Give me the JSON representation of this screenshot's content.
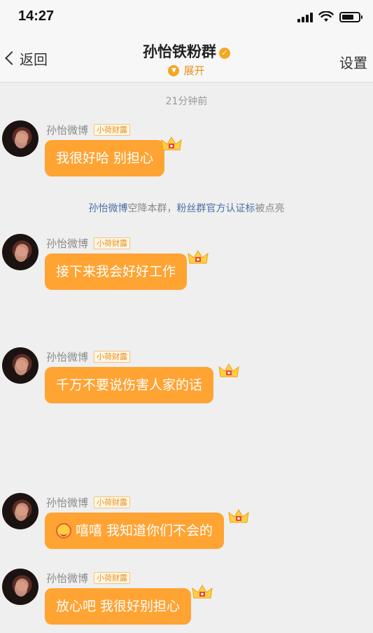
{
  "status_bar": {
    "time": "14:27"
  },
  "nav": {
    "back_label": "返回",
    "title": "孙怡铁粉群",
    "expand_label": "展开",
    "settings_label": "设置"
  },
  "timestamp": "21分钟前",
  "system_notice": {
    "user": "孙怡微博",
    "text_mid": "空降本群，",
    "badge": "粉丝群官方认证标",
    "text_end": "被点亮"
  },
  "messages": [
    {
      "sender": "孙怡微博",
      "tag": "小荷财露",
      "text": "我很好哈 别担心"
    },
    {
      "sender": "孙怡微博",
      "tag": "小荷财露",
      "text": "接下来我会好好工作"
    },
    {
      "sender": "孙怡微博",
      "tag": "小荷财露",
      "text": "千万不要说伤害人家的话"
    },
    {
      "sender": "孙怡微博",
      "tag": "小荷财露",
      "text": "嘻嘻 我知道你们不会的",
      "emoji": "smiling-face-with-hearts"
    },
    {
      "sender": "孙怡微博",
      "tag": "小荷财露",
      "text": "放心吧 我很好别担心"
    }
  ],
  "colors": {
    "bubble": "#ffa333",
    "accent": "#e8911f",
    "link": "#4a6fa5",
    "background": "#efefef"
  }
}
